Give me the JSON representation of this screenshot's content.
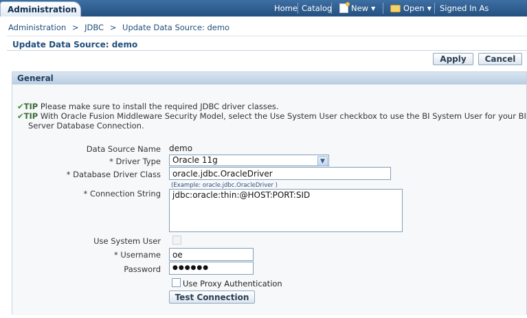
{
  "header": {
    "tab_label": "Administration",
    "nav": {
      "home": "Home",
      "catalog": "Catalog",
      "new": "New",
      "open": "Open",
      "signed_in": "Signed In As"
    }
  },
  "breadcrumb": {
    "items": [
      "Administration",
      "JDBC",
      "Update Data Source: demo"
    ],
    "separator": ">"
  },
  "page_title": "Update Data Source: demo",
  "actions": {
    "apply": "Apply",
    "cancel": "Cancel"
  },
  "section": {
    "title": "General",
    "tips": [
      {
        "label": "TIP",
        "text": "Please make sure to install the required JDBC driver classes."
      },
      {
        "label": "TIP",
        "text": "With Oracle Fusion Middleware Security Model, select the Use System User checkbox to use the BI System User for your BI",
        "text2": "Server Database Connection."
      }
    ]
  },
  "form": {
    "data_source_name": {
      "label": "Data Source Name",
      "value": "demo"
    },
    "driver_type": {
      "label": "* Driver Type",
      "value": "Oracle 11g"
    },
    "driver_class": {
      "label": "* Database Driver Class",
      "value": "oracle.jdbc.OracleDriver",
      "hint": "(Example: oracle.jdbc.OracleDriver )"
    },
    "connection_string": {
      "label": "* Connection String",
      "value": "jdbc:oracle:thin:@HOST:PORT:SID"
    },
    "use_system_user": {
      "label": "Use System User",
      "checked": false
    },
    "username": {
      "label": "* Username",
      "value": "oe"
    },
    "password": {
      "label": "Password",
      "value": "●●●●●●"
    },
    "proxy_auth": {
      "label": "Use Proxy Authentication",
      "checked": false
    },
    "test_connection": "Test Connection"
  },
  "colors": {
    "header_bg": "#2f5f92",
    "section_header": "#c8d8e8",
    "link": "#1f4e7a"
  }
}
